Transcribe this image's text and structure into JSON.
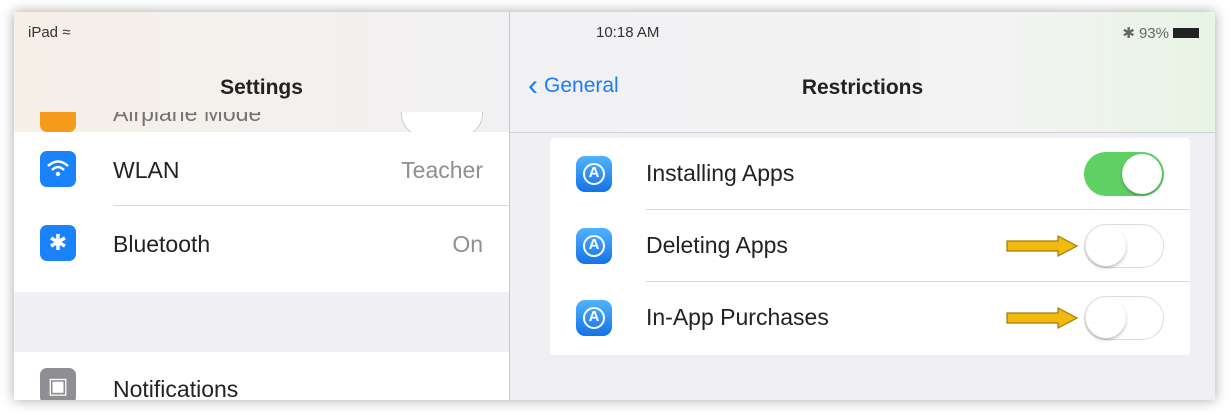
{
  "status": {
    "carrier": "iPad",
    "time": "10:18 AM",
    "battery": "93%"
  },
  "master": {
    "title": "Settings",
    "partial_top_label": "Airplane Mode",
    "items": [
      {
        "label": "WLAN",
        "value": "Teacher",
        "icon": "wifi-icon",
        "color": "#1a82fb"
      },
      {
        "label": "Bluetooth",
        "value": "On",
        "icon": "bluetooth-icon",
        "color": "#1a82fb"
      },
      {
        "label": "Notifications",
        "value": "",
        "icon": "notifications-icon",
        "color": "#8e8e93"
      }
    ]
  },
  "detail": {
    "back_label": "General",
    "title": "Restrictions",
    "rows": [
      {
        "label": "Installing Apps",
        "on": true,
        "icon": "app-store-icon"
      },
      {
        "label": "Deleting Apps",
        "on": false,
        "icon": "app-store-icon",
        "highlighted": true
      },
      {
        "label": "In-App Purchases",
        "on": false,
        "icon": "app-store-icon",
        "highlighted": true
      }
    ]
  },
  "colors": {
    "accent": "#1a7cf6",
    "toggle_on": "#5fd064",
    "arrow": "#f2b90f"
  }
}
